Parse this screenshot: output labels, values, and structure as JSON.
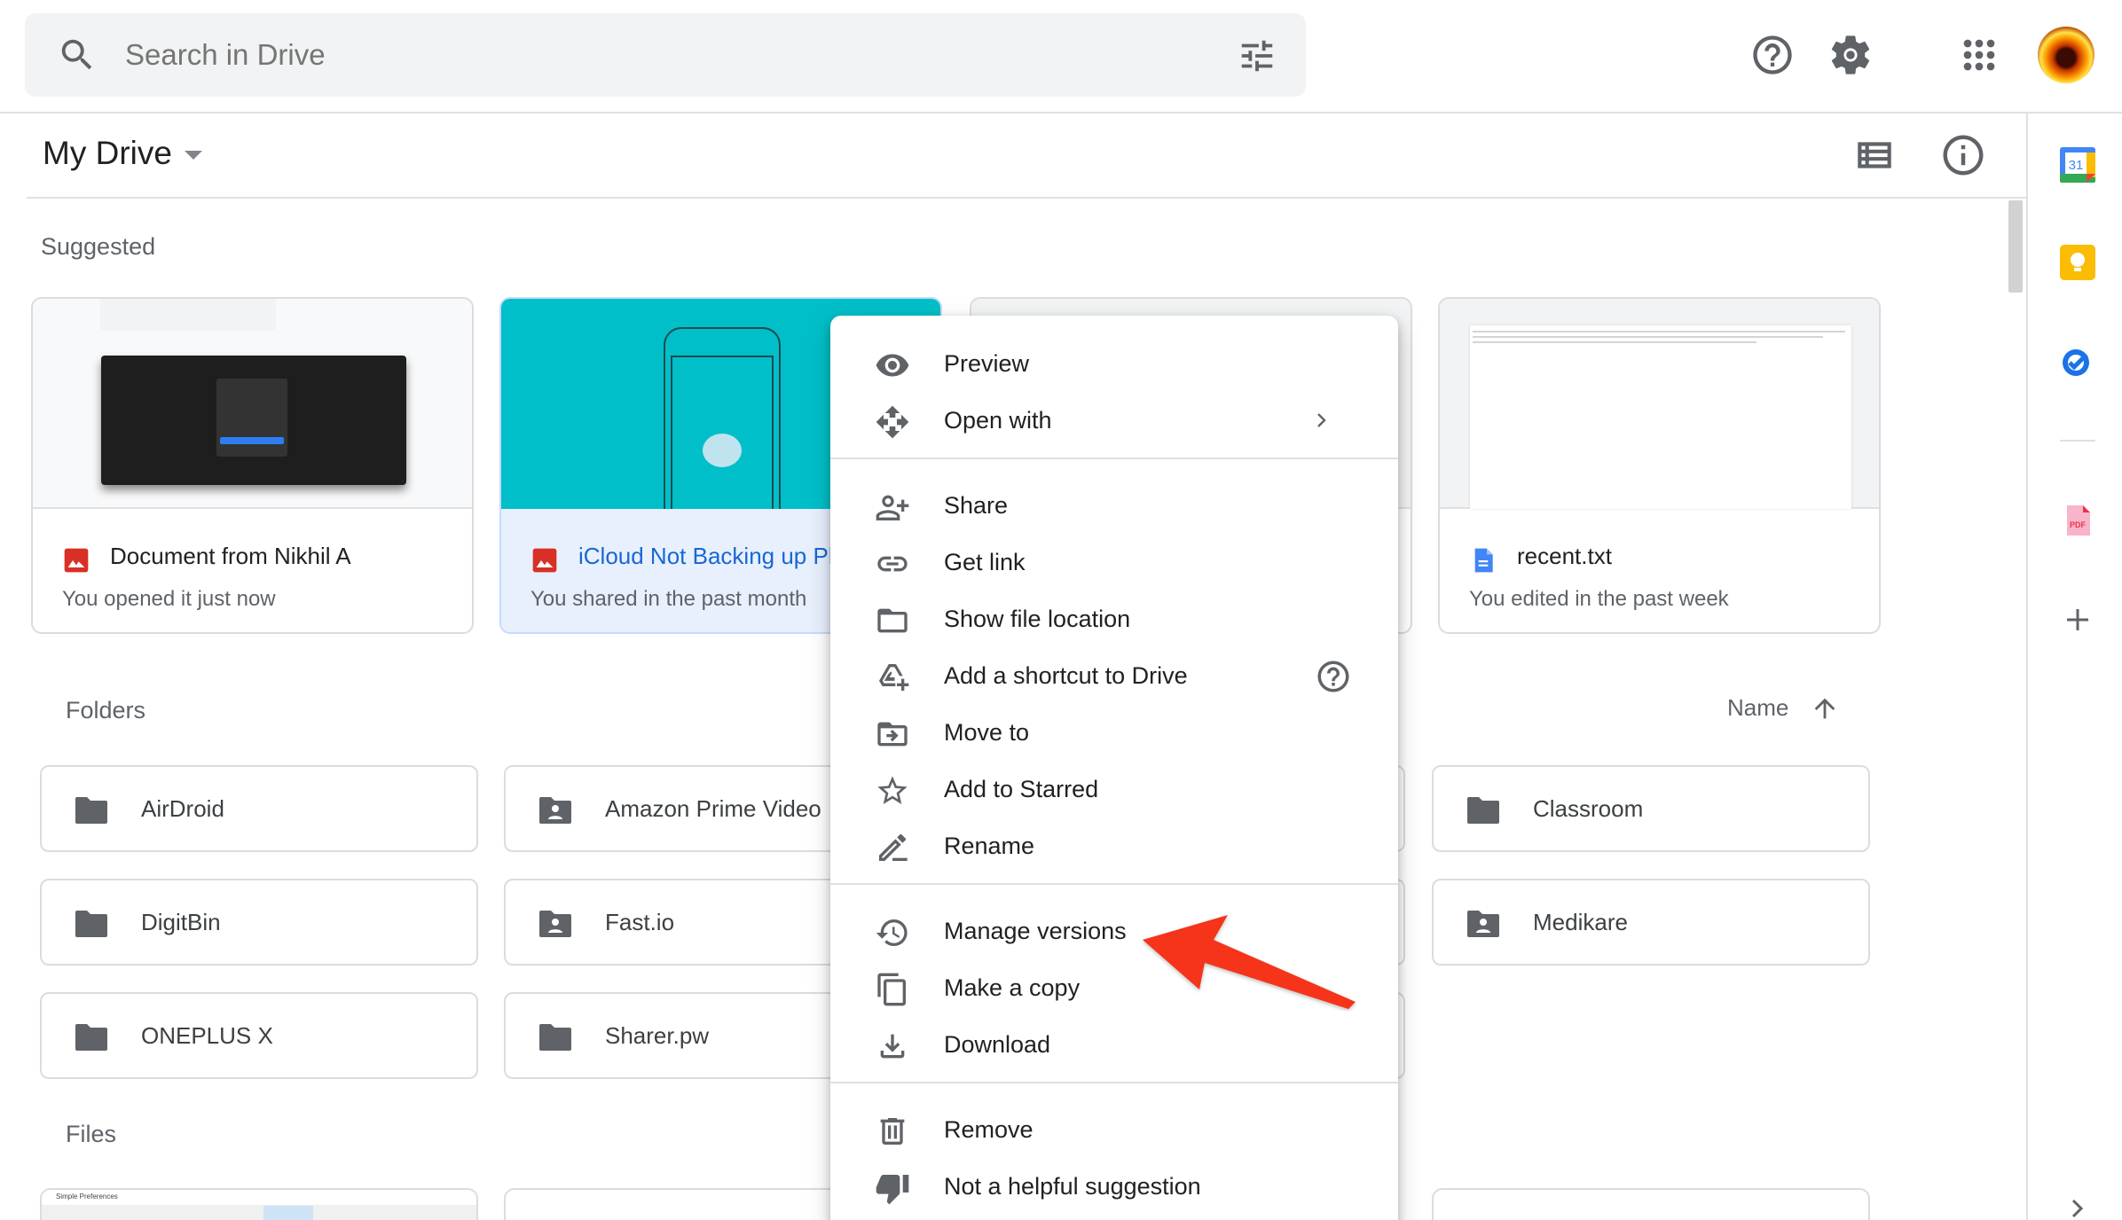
{
  "search": {
    "placeholder": "Search in Drive"
  },
  "header": {
    "title": "My Drive",
    "help_label": "Support",
    "settings_label": "Settings",
    "apps_label": "Google apps",
    "list_view_label": "List layout",
    "info_label": "View details"
  },
  "suggested": {
    "label": "Suggested",
    "cards": [
      {
        "name": "Document from Nikhil A",
        "meta": "You opened it just now",
        "type": "image",
        "icon": "image-file-icon"
      },
      {
        "name": "iCloud Not Backing up Photos",
        "name_visible": "iCloud Not Backing up P",
        "meta": "You shared in the past month",
        "type": "image",
        "icon": "image-file-icon",
        "selected": true
      },
      {
        "name": "",
        "meta": "",
        "type": "hidden"
      },
      {
        "name": "recent.txt",
        "meta": "You edited in the past week",
        "type": "document",
        "icon": "docs-file-icon"
      }
    ]
  },
  "folders": {
    "label": "Folders",
    "sort": {
      "label": "Name",
      "direction": "ascending"
    },
    "items": [
      {
        "name": "AirDroid",
        "shared": false
      },
      {
        "name": "Amazon Prime Video",
        "shared": true
      },
      {
        "name": "Classroom",
        "shared": false
      },
      {
        "name": "DigitBin",
        "shared": false
      },
      {
        "name": "Fast.io",
        "shared": true
      },
      {
        "name": "Medikare",
        "shared": true
      },
      {
        "name": "ONEPLUS X",
        "shared": false
      },
      {
        "name": "Sharer.pw",
        "shared": false
      }
    ]
  },
  "files": {
    "label": "Files",
    "first_file_thumb_title": "Simple Preferences"
  },
  "context_menu": {
    "groups": [
      [
        {
          "label": "Preview",
          "icon": "eye-icon"
        },
        {
          "label": "Open with",
          "icon": "open-with-icon",
          "submenu": true
        }
      ],
      [
        {
          "label": "Share",
          "icon": "person-add-icon"
        },
        {
          "label": "Get link",
          "icon": "link-icon"
        },
        {
          "label": "Show file location",
          "icon": "folder-outline-icon"
        },
        {
          "label": "Add a shortcut to Drive",
          "icon": "add-shortcut-icon",
          "help": true
        },
        {
          "label": "Move to",
          "icon": "move-to-folder-icon"
        },
        {
          "label": "Add to Starred",
          "icon": "star-outline-icon"
        },
        {
          "label": "Rename",
          "icon": "pencil-icon"
        }
      ],
      [
        {
          "label": "Manage versions",
          "icon": "history-icon",
          "highlighted_by_annotation": true
        },
        {
          "label": "Make a copy",
          "icon": "copy-icon"
        },
        {
          "label": "Download",
          "icon": "download-icon"
        }
      ],
      [
        {
          "label": "Remove",
          "icon": "trash-icon"
        },
        {
          "label": "Not a helpful suggestion",
          "icon": "thumbs-down-icon"
        }
      ]
    ]
  },
  "side_panel": {
    "apps": [
      {
        "name": "Calendar",
        "icon": "calendar-icon",
        "badge": "31"
      },
      {
        "name": "Keep",
        "icon": "keep-icon"
      },
      {
        "name": "Tasks",
        "icon": "tasks-icon"
      },
      {
        "name": "PDF",
        "icon": "pdf-icon",
        "badge": "PDF"
      },
      {
        "name": "Get add-ons",
        "icon": "plus-icon"
      }
    ]
  },
  "colors": {
    "accent_blue": "#1a73e8",
    "selected_card_bg": "#e8f0fe",
    "selected_card_text": "#1967d2",
    "annotation_arrow": "#f5341a",
    "icon_gray": "#5f6368",
    "card_thumb_teal": "#00bfc8"
  }
}
